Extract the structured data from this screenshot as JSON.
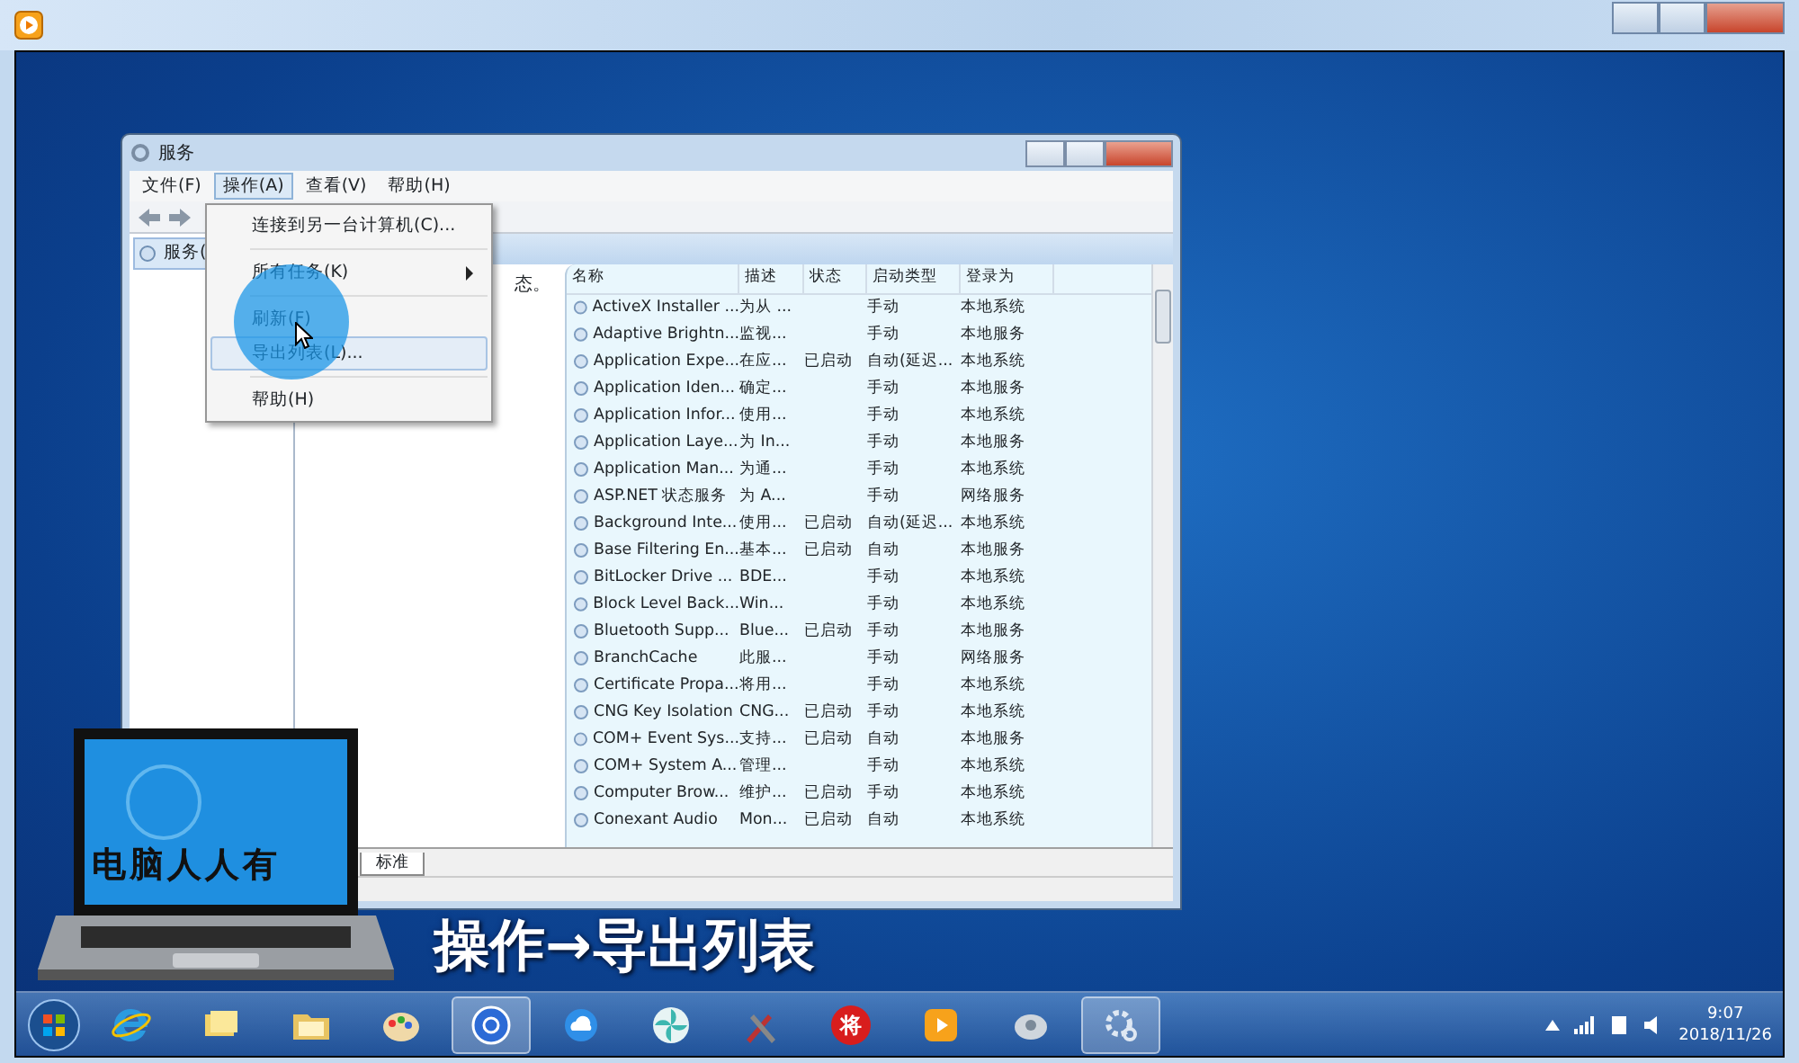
{
  "services_window": {
    "title": "服务",
    "menu": [
      {
        "label": "文件(F)",
        "selected": false
      },
      {
        "label": "操作(A)",
        "selected": true
      },
      {
        "label": "查看(V)",
        "selected": false
      },
      {
        "label": "帮助(H)",
        "selected": false
      }
    ],
    "tree": [
      {
        "label": "服务(",
        "selected": true
      }
    ],
    "description": "态。",
    "table": {
      "columns": [
        "名称",
        "描述",
        "状态",
        "启动类型",
        "登录为"
      ],
      "rows": [
        [
          "ActiveX Installer ...",
          "为从 ...",
          "",
          "手动",
          "本地系统"
        ],
        [
          "Adaptive Brightn...",
          "监视...",
          "",
          "手动",
          "本地服务"
        ],
        [
          "Application Expe...",
          "在应...",
          "已启动",
          "自动(延迟...",
          "本地系统"
        ],
        [
          "Application Iden...",
          "确定...",
          "",
          "手动",
          "本地服务"
        ],
        [
          "Application Infor...",
          "使用...",
          "",
          "手动",
          "本地系统"
        ],
        [
          "Application Laye...",
          "为 In...",
          "",
          "手动",
          "本地服务"
        ],
        [
          "Application Man...",
          "为通...",
          "",
          "手动",
          "本地系统"
        ],
        [
          "ASP.NET 状态服务",
          "为 A...",
          "",
          "手动",
          "网络服务"
        ],
        [
          "Background Inte...",
          "使用...",
          "已启动",
          "自动(延迟...",
          "本地系统"
        ],
        [
          "Base Filtering En...",
          "基本...",
          "已启动",
          "自动",
          "本地服务"
        ],
        [
          "BitLocker Drive ...",
          "BDE...",
          "",
          "手动",
          "本地系统"
        ],
        [
          "Block Level Back...",
          "Win...",
          "",
          "手动",
          "本地系统"
        ],
        [
          "Bluetooth Supp...",
          "Blue...",
          "已启动",
          "手动",
          "本地服务"
        ],
        [
          "BranchCache",
          "此服...",
          "",
          "手动",
          "网络服务"
        ],
        [
          "Certificate Propa...",
          "将用...",
          "",
          "手动",
          "本地系统"
        ],
        [
          "CNG Key Isolation",
          "CNG...",
          "已启动",
          "手动",
          "本地系统"
        ],
        [
          "COM+ Event Sys...",
          "支持...",
          "已启动",
          "自动",
          "本地服务"
        ],
        [
          "COM+ System A...",
          "管理...",
          "",
          "手动",
          "本地系统"
        ],
        [
          "Computer Brow...",
          "维护...",
          "已启动",
          "手动",
          "本地系统"
        ],
        [
          "Conexant Audio",
          "Mon...",
          "已启动",
          "自动",
          "本地系统"
        ]
      ]
    },
    "tabs": [
      {
        "label": "标准",
        "selected": true
      }
    ]
  },
  "dropdown": {
    "items": [
      {
        "kind": "item",
        "label": "连接到另一台计算机(C)...",
        "selected": false
      },
      {
        "kind": "separator"
      },
      {
        "kind": "submenu",
        "label": "所有任务(K)",
        "selected": false
      },
      {
        "kind": "separator"
      },
      {
        "kind": "item",
        "label": "刷新(F)",
        "selected": false
      },
      {
        "kind": "item",
        "label": "导出列表(L)...",
        "selected": true
      },
      {
        "kind": "separator"
      },
      {
        "kind": "item",
        "label": "帮助(H)",
        "selected": false
      }
    ]
  },
  "logo_text": "电脑人人有",
  "caption": "操作→导出列表",
  "taskbar": {
    "apps": [
      {
        "kind": "ie",
        "selected": false
      },
      {
        "kind": "notes",
        "selected": false
      },
      {
        "kind": "folder",
        "selected": false
      },
      {
        "kind": "paint",
        "selected": false
      },
      {
        "kind": "media",
        "selected": true
      },
      {
        "kind": "cloud",
        "selected": false
      },
      {
        "kind": "pinwheel",
        "selected": false
      },
      {
        "kind": "tools",
        "selected": false
      },
      {
        "kind": "chess",
        "label": "将",
        "selected": false
      },
      {
        "kind": "player",
        "selected": false
      },
      {
        "kind": "disk",
        "selected": false
      },
      {
        "kind": "gear",
        "selected": true
      }
    ],
    "time": "9:07",
    "date": "2018/11/26"
  }
}
